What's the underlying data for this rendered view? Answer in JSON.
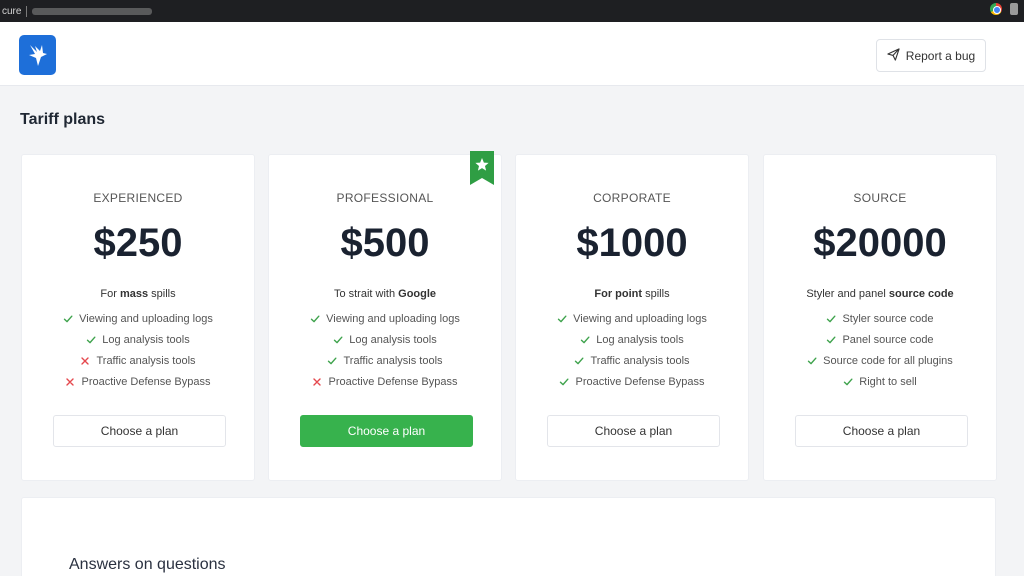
{
  "browser": {
    "security_text": "cure"
  },
  "header": {
    "report_button_label": "Report a bug"
  },
  "page": {
    "title": "Tariff plans"
  },
  "plans": [
    {
      "tier": "EXPERIENCED",
      "price": "$250",
      "desc_prefix": "For ",
      "desc_bold": "mass",
      "desc_suffix": " spills",
      "features": [
        {
          "text": "Viewing and uploading logs",
          "included": true
        },
        {
          "text": "Log analysis tools",
          "included": true
        },
        {
          "text": "Traffic analysis tools",
          "included": false
        },
        {
          "text": "Proactive Defense Bypass",
          "included": false
        }
      ],
      "button_label": "Choose a plan",
      "featured": false
    },
    {
      "tier": "PROFESSIONAL",
      "price": "$500",
      "desc_prefix": "To strait with ",
      "desc_bold": "Google",
      "desc_suffix": "",
      "features": [
        {
          "text": "Viewing and uploading logs",
          "included": true
        },
        {
          "text": "Log analysis tools",
          "included": true
        },
        {
          "text": "Traffic analysis tools",
          "included": true
        },
        {
          "text": "Proactive Defense Bypass",
          "included": false
        }
      ],
      "button_label": "Choose a plan",
      "featured": true
    },
    {
      "tier": "CORPORATE",
      "price": "$1000",
      "desc_prefix": "",
      "desc_bold": "For point",
      "desc_suffix": " spills",
      "features": [
        {
          "text": "Viewing and uploading logs",
          "included": true
        },
        {
          "text": "Log analysis tools",
          "included": true
        },
        {
          "text": "Traffic analysis tools",
          "included": true
        },
        {
          "text": "Proactive Defense Bypass",
          "included": true
        }
      ],
      "button_label": "Choose a plan",
      "featured": false
    },
    {
      "tier": "SOURCE",
      "price": "$20000",
      "desc_prefix": "Styler and panel ",
      "desc_bold": "source code",
      "desc_suffix": "",
      "features": [
        {
          "text": "Styler source code",
          "included": true
        },
        {
          "text": "Panel source code",
          "included": true
        },
        {
          "text": "Source code for all plugins",
          "included": true
        },
        {
          "text": "Right to sell",
          "included": true
        }
      ],
      "button_label": "Choose a plan",
      "featured": false
    }
  ],
  "faq": {
    "title": "Answers on questions"
  },
  "colors": {
    "primary_green": "#37b24d",
    "check_green": "#3fa34d",
    "cross_red": "#e5484d",
    "logo_blue": "#1e6fd9",
    "ribbon_green": "#2f9e44"
  },
  "icons": {
    "logo": "bird-logo-icon",
    "report": "paper-plane-icon",
    "featured": "star-icon",
    "included": "check-icon",
    "excluded": "cross-icon"
  }
}
